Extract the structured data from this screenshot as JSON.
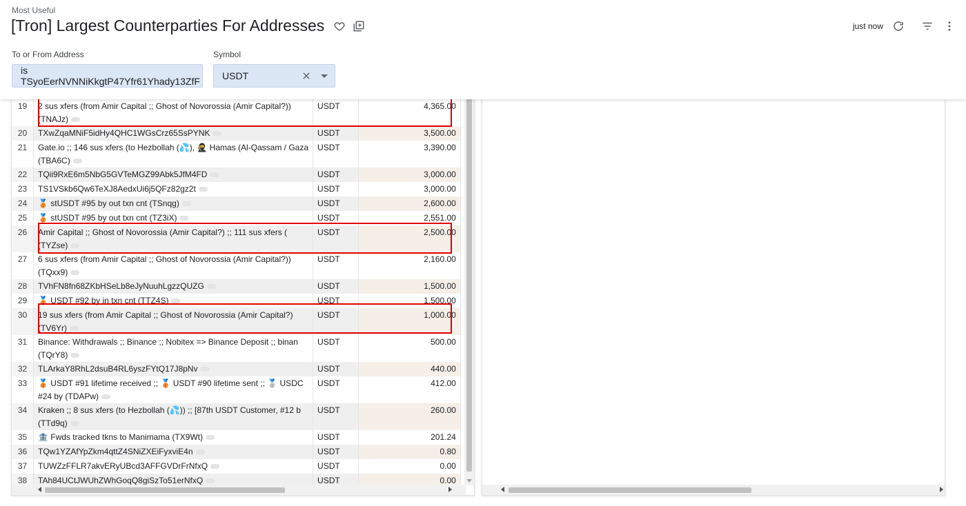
{
  "header": {
    "breadcrumb": "Most Useful",
    "title": "[Tron] Largest Counterparties For Addresses",
    "refresh_time": "just now"
  },
  "icons": {
    "favorite": "heart-outline-icon",
    "add_to_collection": "add-to-collection-icon",
    "refresh": "refresh-icon",
    "filter": "filter-lines-icon",
    "more": "more-vert-icon",
    "clear": "close-icon",
    "dropdown": "caret-down-icon"
  },
  "filters": {
    "address": {
      "label": "To or From Address",
      "value": "is TSyoEerNVNNiKkgtP47Yfr61Yhady13ZfF"
    },
    "symbol": {
      "label": "Symbol",
      "value": "USDT"
    }
  },
  "colors": {
    "filter_bg": "#dbe7f5",
    "highlight": "#e00000",
    "row_alt": "#efefef",
    "value_alt": "#f5efe8"
  },
  "table": {
    "rows": [
      {
        "num": "19",
        "name": "2 sus xfers (from Amir Capital ;; Ghost of Novorossia (Amir Capital?))",
        "tag": "(TNAJz)",
        "symbol": "USDT",
        "value": "4,365.00"
      },
      {
        "num": "20",
        "name": "",
        "tag": "TXwZqaMNiF5idHy4QHC1WGsCrz65SsPYNK",
        "symbol": "USDT",
        "value": "3,500.00"
      },
      {
        "num": "21",
        "name": "Gate.io ;; 146 sus xfers (to Hezbollah (💦), 🥷 Hamas (Al-Qassam / Gaza",
        "tag": "(TBA6C)",
        "symbol": "USDT",
        "value": "3,390.00"
      },
      {
        "num": "22",
        "name": "",
        "tag": "TQii9RxE6m5NbG5GVTeMGZ99Abk5JfM4FD",
        "symbol": "USDT",
        "value": "3,000.00"
      },
      {
        "num": "23",
        "name": "",
        "tag": "TS1VSkb6Qw6TeXJ8AedxUi6j5QFz82gz2t",
        "symbol": "USDT",
        "value": "3,000.00"
      },
      {
        "num": "24",
        "name": "",
        "tag": "🥉 stUSDT #95 by out txn cnt (TSnqg)",
        "symbol": "USDT",
        "value": "2,600.00"
      },
      {
        "num": "25",
        "name": "",
        "tag": "🥉 stUSDT #95 by out txn cnt (TZ3iX)",
        "symbol": "USDT",
        "value": "2,551.00"
      },
      {
        "num": "26",
        "name": "Amir Capital ;; Ghost of Novorossia (Amir Capital?) ;; 111 sus xfers (",
        "tag": "(TYZse)",
        "symbol": "USDT",
        "value": "2,500.00"
      },
      {
        "num": "27",
        "name": "6 sus xfers (from Amir Capital ;; Ghost of Novorossia (Amir Capital?))",
        "tag": "(TQxx9)",
        "symbol": "USDT",
        "value": "2,160.00"
      },
      {
        "num": "28",
        "name": "",
        "tag": "TVhFN8fn68ZKbHSeLb8eJyNuuhLgzzQUZG",
        "symbol": "USDT",
        "value": "1,500.00"
      },
      {
        "num": "29",
        "name": "",
        "tag": "🥉 USDT #92 by in txn cnt (TTZ4S)",
        "symbol": "USDT",
        "value": "1,500.00"
      },
      {
        "num": "30",
        "name": "19 sus xfers (from Amir Capital ;; Ghost of Novorossia (Amir Capital?)",
        "tag": "(TV6Yr)",
        "symbol": "USDT",
        "value": "1,000.00"
      },
      {
        "num": "31",
        "name": "Binance: Withdrawals ;; Binance ;; Nobitex => Binance Deposit ;; binan",
        "tag": "(TQrY8)",
        "symbol": "USDT",
        "value": "500.00"
      },
      {
        "num": "32",
        "name": "",
        "tag": "TLArkaY8RhL2dsuB4RL6yszFYtQ17J8pNv",
        "symbol": "USDT",
        "value": "440.00"
      },
      {
        "num": "33",
        "name": "🥉 USDT #91 lifetime received ;; 🥉 USDT #90 lifetime sent ;; 🥈 USDC",
        "tag": "#24 by (TDAPw)",
        "symbol": "USDT",
        "value": "412.00"
      },
      {
        "num": "34",
        "name": "Kraken ;; 8 sus xfers (to Hezbollah (💦)) ;; [87th USDT Customer, #12 b",
        "tag": "(TTd9q)",
        "symbol": "USDT",
        "value": "260.00"
      },
      {
        "num": "35",
        "name": "",
        "tag": "🏦 Fwds tracked tkns to Manimama (TX9Wt)",
        "symbol": "USDT",
        "value": "201.24"
      },
      {
        "num": "36",
        "name": "",
        "tag": "TQw1YZAfYpZkm4qttZ4SNiZXEiFyxviE4n",
        "symbol": "USDT",
        "value": "0.80"
      },
      {
        "num": "37",
        "name": "",
        "tag": "TUWZzFFLR7akvERyUBcd3AFFGVDrFrNfxQ",
        "symbol": "USDT",
        "value": "0.00"
      },
      {
        "num": "38",
        "name": "",
        "tag": "TAh84UCtJWUhZWhGoqQ8giSzTo51erNfxQ",
        "symbol": "USDT",
        "value": "0.00"
      }
    ]
  }
}
